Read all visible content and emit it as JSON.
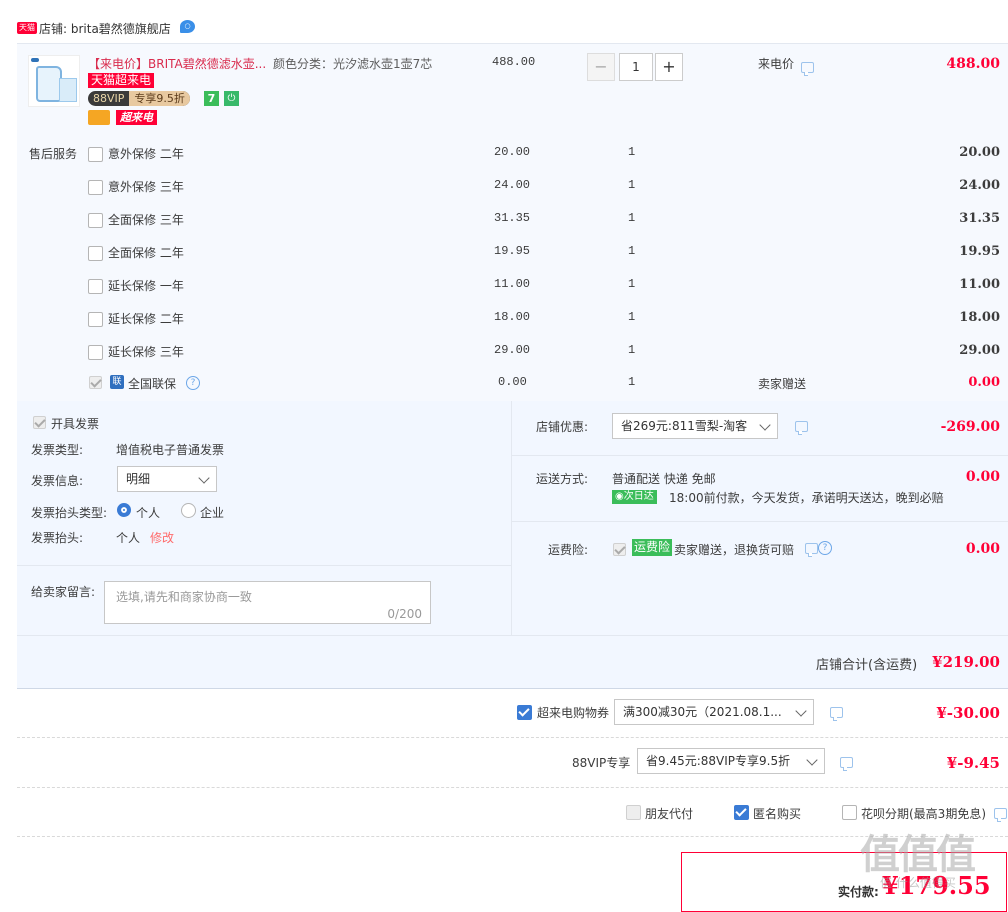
{
  "store": {
    "badge": "天猫",
    "label": "店铺: brita碧然德旗舰店"
  },
  "product": {
    "title": "【来电价】BRITA碧然德滤水壶...",
    "sku": "颜色分类：光汐滤水壶1壶7芯",
    "unit_price": "488.00",
    "quantity": "1",
    "price_type": "来电价",
    "subtotal": "488.00",
    "tag_tmall": "天猫超来电",
    "tag_vip": "88VIP",
    "tag_vip_discount": "专享9.5折",
    "tag_cat": "超来电"
  },
  "services": {
    "section_label": "售后服务",
    "items": [
      {
        "name": "意外保修 二年",
        "price": "20.00",
        "qty": "1",
        "total": "20.00"
      },
      {
        "name": "意外保修 三年",
        "price": "24.00",
        "qty": "1",
        "total": "24.00"
      },
      {
        "name": "全面保修 三年",
        "price": "31.35",
        "qty": "1",
        "total": "31.35"
      },
      {
        "name": "全面保修 二年",
        "price": "19.95",
        "qty": "1",
        "total": "19.95"
      },
      {
        "name": "延长保修 一年",
        "price": "11.00",
        "qty": "1",
        "total": "11.00"
      },
      {
        "name": "延长保修 二年",
        "price": "18.00",
        "qty": "1",
        "total": "18.00"
      },
      {
        "name": "延长保修 三年",
        "price": "29.00",
        "qty": "1",
        "total": "29.00"
      }
    ],
    "joint": {
      "badge": "联",
      "name": "全国联保",
      "price": "0.00",
      "qty": "1",
      "type": "卖家赠送",
      "total": "0.00"
    }
  },
  "invoice": {
    "open_label": "开具发票",
    "type_label": "发票类型:",
    "type_value": "增值税电子普通发票",
    "info_label": "发票信息:",
    "info_value": "明细",
    "header_type_label": "发票抬头类型:",
    "header_type_personal": "个人",
    "header_type_company": "企业",
    "header_label": "发票抬头:",
    "header_value": "个人",
    "modify": "修改"
  },
  "message": {
    "label": "给卖家留言:",
    "placeholder": "选填,请先和商家协商一致",
    "counter": "0/200"
  },
  "discount": {
    "label": "店铺优惠:",
    "value": "省269元:811雪梨-淘客",
    "amount": "-269.00"
  },
  "shipping": {
    "label": "运送方式:",
    "method": "普通配送 快递 免邮",
    "next_day_badge": "次日达",
    "note": "18:00前付款，今天发货，承诺明天送达，晚到必赔",
    "amount": "0.00"
  },
  "insurance": {
    "label": "运费险:",
    "badge": "运费险",
    "text": "卖家赠送，退换货可赔",
    "amount": "0.00"
  },
  "store_total": {
    "label": "店铺合计(含运费)",
    "amount": "¥219.00"
  },
  "coupon": {
    "label": "超来电购物券",
    "value": "满300减30元（2021.08.1...",
    "amount": "¥-30.00"
  },
  "vip": {
    "label": "88VIP专享",
    "value": "省9.45元:88VIP专享9.5折",
    "amount": "¥-9.45"
  },
  "options": {
    "friend_pay": "朋友代付",
    "anonymous": "匿名购买",
    "huabei": "花呗分期(最高3期免息)"
  },
  "pay": {
    "label": "实付款:",
    "amount": "¥179.55"
  },
  "watermark": "值 什么值得买",
  "colors": {
    "accent": "#ff0036",
    "link": "#3a7bd5",
    "panel": "#f2f7ff"
  }
}
